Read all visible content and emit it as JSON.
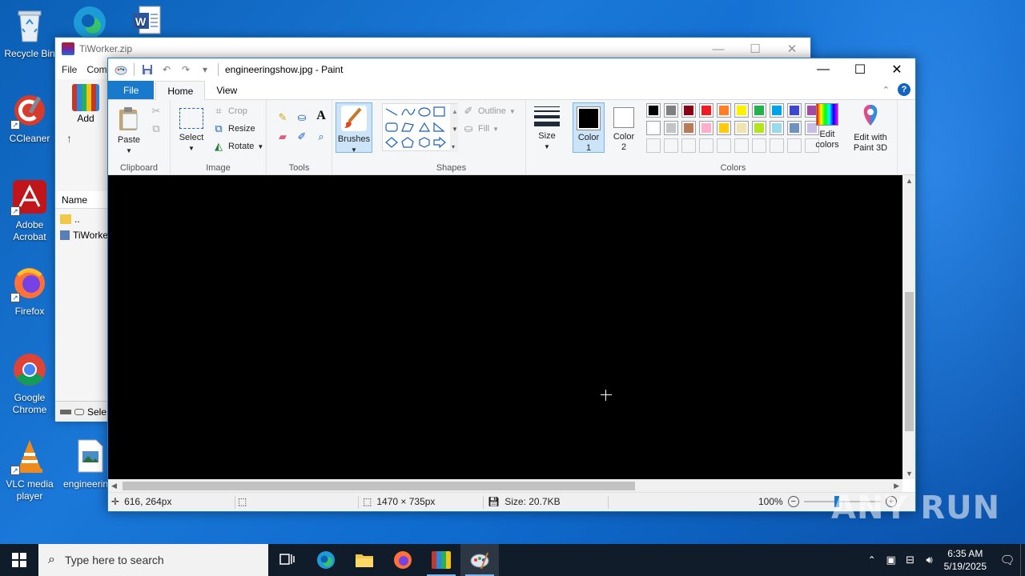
{
  "desktop": {
    "icons": [
      {
        "label": "Recycle Bin",
        "icon": "recycle-bin-icon"
      },
      {
        "label": "CCleaner",
        "icon": "ccleaner-icon"
      },
      {
        "label": "Adobe Acrobat",
        "icon": "adobe-acrobat-icon"
      },
      {
        "label": "Firefox",
        "icon": "firefox-icon"
      },
      {
        "label": "Google Chrome",
        "icon": "chrome-icon"
      },
      {
        "label": "VLC media player",
        "icon": "vlc-icon"
      },
      {
        "label": "engineerin",
        "icon": "image-file-icon"
      }
    ],
    "watermark": "ANY RUN"
  },
  "winrar": {
    "title": "TiWorker.zip",
    "menu": [
      "File",
      "Com"
    ],
    "add_label": "Add",
    "column_name": "Name",
    "rows": [
      "..",
      "TiWorke"
    ],
    "status": "Sele"
  },
  "paint": {
    "title": "engineeringshow.jpg - Paint",
    "tabs": {
      "file": "File",
      "home": "Home",
      "view": "View"
    },
    "ribbon": {
      "clipboard": {
        "group": "Clipboard",
        "paste": "Paste"
      },
      "image": {
        "group": "Image",
        "select": "Select",
        "crop": "Crop",
        "resize": "Resize",
        "rotate": "Rotate"
      },
      "tools": {
        "group": "Tools"
      },
      "brushes": "Brushes",
      "shapes": {
        "group": "Shapes",
        "outline": "Outline",
        "fill": "Fill"
      },
      "size": "Size",
      "colors": {
        "group": "Colors",
        "color1": "Color 1",
        "color2": "Color 2",
        "edit_colors": "Edit colors",
        "edit_paint3d": "Edit with Paint 3D",
        "color1_value": "#000000",
        "color2_value": "#ffffff",
        "palette_row1": [
          "#000000",
          "#7f7f7f",
          "#880015",
          "#ed1c24",
          "#ff7f27",
          "#fff200",
          "#22b14c",
          "#00a2e8",
          "#3f48cc",
          "#a349a4"
        ],
        "palette_row2": [
          "#ffffff",
          "#c3c3c3",
          "#b97a57",
          "#ffaec9",
          "#ffc90e",
          "#efe4b0",
          "#b5e61d",
          "#99d9ea",
          "#7092be",
          "#c8bfe7"
        ]
      }
    },
    "status": {
      "cursor_pos": "616, 264px",
      "dimensions": "1470 × 735px",
      "size": "Size: 20.7KB",
      "zoom": "100%"
    }
  },
  "taskbar": {
    "search_placeholder": "Type here to search",
    "time": "6:35 AM",
    "date": "5/19/2025"
  }
}
